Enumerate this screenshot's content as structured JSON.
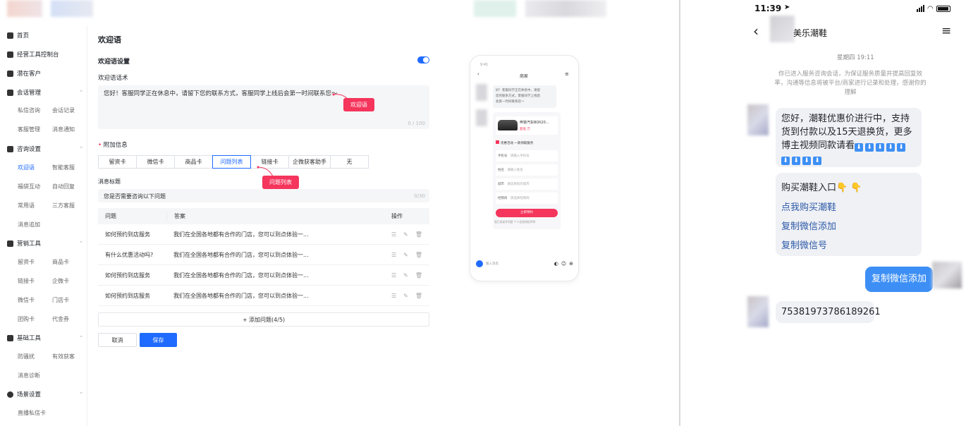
{
  "sidebar": {
    "items": [
      {
        "label": "首页"
      },
      {
        "label": "经营工具控制台"
      },
      {
        "label": "潜在客户"
      },
      {
        "label": "会话管理"
      },
      {
        "label": "咨询设置"
      },
      {
        "label": "营销工具"
      },
      {
        "label": "基础工具"
      },
      {
        "label": "场景设置"
      }
    ],
    "subs": {
      "s1": "私信咨询",
      "s2": "会话记录",
      "s3": "客服管理",
      "s4": "消息通知",
      "s5": "欢迎语",
      "s6": "智能客服",
      "s7": "福袋互动",
      "s8": "自动回复",
      "s9": "常用语",
      "s10": "三方客服",
      "s11": "消息追加",
      "s12": "留资卡",
      "s13": "商品卡",
      "s14": "链接卡",
      "s15": "企微卡",
      "s16": "微信卡",
      "s17": "门店卡",
      "s18": "团购卡",
      "s19": "代金券",
      "s20": "防骚扰",
      "s21": "有效获客",
      "s22": "消息诊断",
      "s23": "直播私信卡"
    }
  },
  "main": {
    "page_title": "欢迎语",
    "section_title": "欢迎语设置",
    "speech_label": "欢迎语话术",
    "speech_text": "您好！客服同学正在休息中，请留下您的联系方式，客服同学上线后会第一时间联系您～",
    "speech_counter": "0 / 100",
    "tip_welcome": "欢迎语",
    "extra_label": "附加信息",
    "tabs": [
      "留资卡",
      "微信卡",
      "商品卡",
      "问题列表",
      "链接卡",
      "企微获客助手",
      "无"
    ],
    "tip_list": "问题列表",
    "msg_title_label": "消息标题",
    "msg_title_value": "您是否需要咨询以下问题",
    "msg_title_counter": "0/30",
    "table": {
      "headers": [
        "问题",
        "答案",
        "操作"
      ],
      "rows": [
        {
          "q": "如何预约到店服务",
          "a": "我们在全国各地都有合作的门店，您可以到点体验一..."
        },
        {
          "q": "有什么优惠活动吗?",
          "a": "我们在全国各地都有合作的门店，您可以到点体验一..."
        },
        {
          "q": "如何预约到店服务",
          "a": "我们在全国各地都有合作的门店，您可以到点体验一..."
        },
        {
          "q": "如何预约到店服务",
          "a": "我们在全国各地都有合作的门店，您可以到点体验一..."
        }
      ]
    },
    "add_label": "+ 添加问题(4/5)",
    "cancel_label": "取消",
    "save_label": "保存"
  },
  "phone": {
    "title": "商家",
    "msg": "好！客服同学正在休息中，请留\n您的联系方式，客服同学上线后\n会第一时间联系您～",
    "car": "奔驰汽车BOX20...",
    "price": "超低 万",
    "benefit": "优惠活动 一款领取服务",
    "f1": "手机号",
    "f1p": "请输入手机号",
    "f2": "姓名",
    "f2p": "请输入姓名",
    "f3": "城市",
    "f3p": "请选择您的城市",
    "f4": "经销商",
    "f4p": "请选择经销商",
    "submit": "立即预约",
    "footer": "我已阅读并同意 个人信息授权声明",
    "input": "输入消息",
    "colors": {
      "submit": "#f5355c"
    }
  },
  "chat": {
    "time": "11:39",
    "title": "美乐潮鞋",
    "date": "星期四 19:11",
    "notice": "你已进入服务咨询会话，为保证服务质量并提高回复效率，沟通等信息将被平台/商家进行记录和处理，感谢你的理解",
    "msg1_line1": "您好，潮鞋优惠价进行中，支持",
    "msg1_line2": "货到付款以及15天退换货，更多",
    "msg1_line3": "博主视频同款请看",
    "menu_title": "购买潮鞋入口👇 👇",
    "menu1": "点我购买潮鞋",
    "menu2": "复制微信添加",
    "menu3": "复制微信号",
    "outgoing": "复制微信添加",
    "number": "75381973786189261"
  },
  "colors": {
    "accent": "#1f6bff",
    "tip": "#f5355c",
    "chat_accent": "#3d8ff5"
  }
}
